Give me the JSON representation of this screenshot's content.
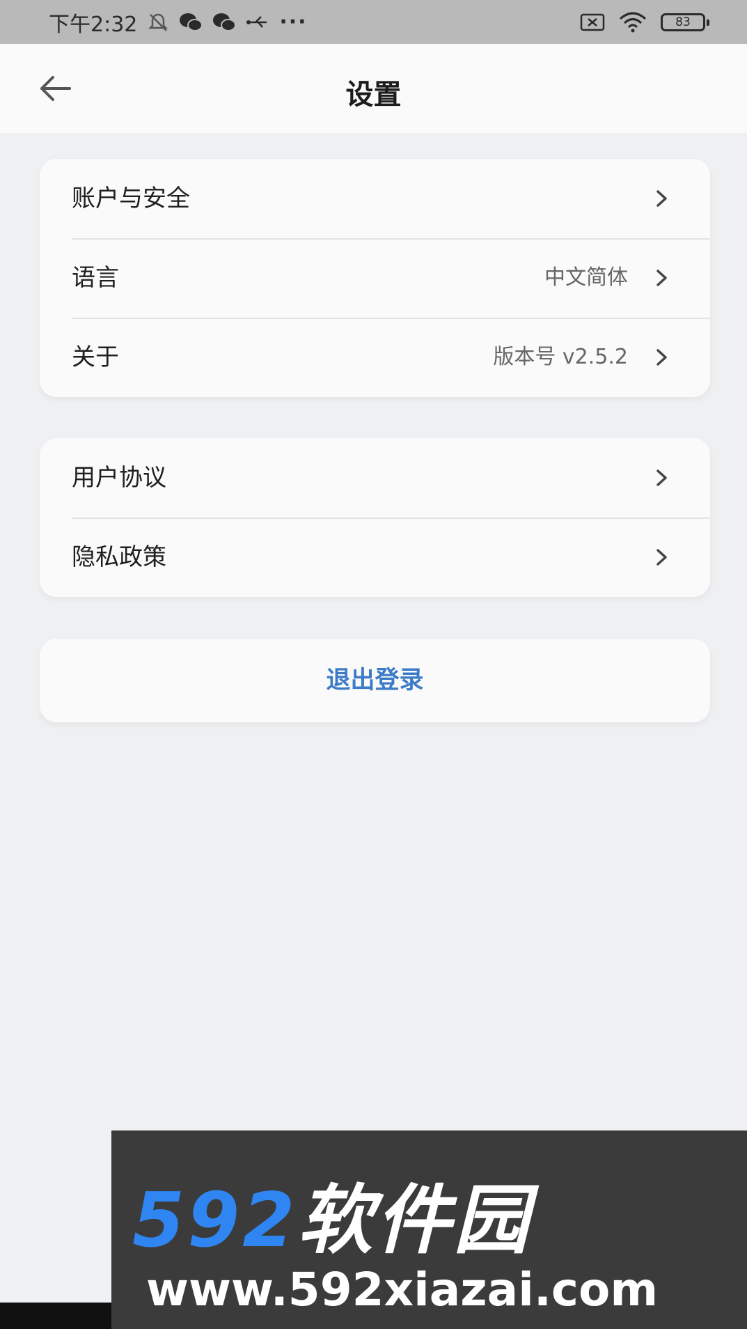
{
  "status_bar": {
    "time": "下午2:32",
    "icons": [
      "bell-off-icon",
      "wechat-icon",
      "wechat-icon",
      "usb-icon",
      "more-dots-icon"
    ],
    "right_icons": [
      "sim-x-icon",
      "wifi-icon"
    ],
    "battery": "83"
  },
  "header": {
    "title": "设置",
    "back_icon": "back-arrow-icon"
  },
  "group1": [
    {
      "label": "账户与安全",
      "value": ""
    },
    {
      "label": "语言",
      "value": "中文简体"
    },
    {
      "label": "关于",
      "value": "版本号 v2.5.2"
    }
  ],
  "group2": [
    {
      "label": "用户协议",
      "value": ""
    },
    {
      "label": "隐私政策",
      "value": ""
    }
  ],
  "logout_label": "退出登录",
  "watermark": {
    "number": "592",
    "text": "软件园",
    "url": "www.592xiazai.com"
  },
  "colors": {
    "background": "#eff0f2",
    "card": "#fafafa",
    "accent": "#3d7bc8",
    "watermark_blue": "#2f86f2"
  }
}
